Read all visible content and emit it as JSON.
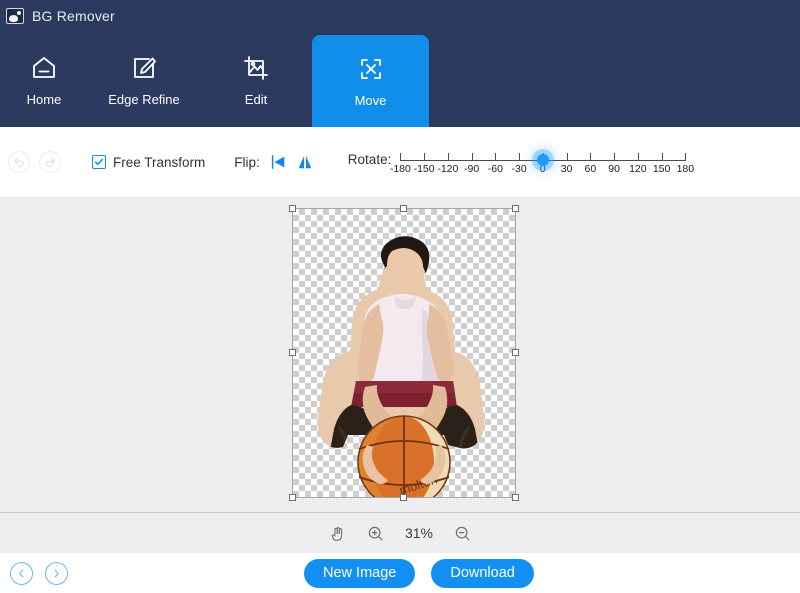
{
  "titlebar": {
    "app_name": "BG Remover",
    "icon": "image-photo-icon"
  },
  "nav": {
    "items": [
      {
        "label": "Home",
        "icon": "home-icon",
        "active": false
      },
      {
        "label": "Edge Refine",
        "icon": "pen-edit-square-icon",
        "active": false
      },
      {
        "label": "Edit",
        "icon": "image-crop-icon",
        "active": false
      },
      {
        "label": "Move",
        "icon": "move-arrows-icon",
        "active": true
      }
    ],
    "active_color": "#108ee9",
    "bar_color": "#2b3a5e"
  },
  "toolbar": {
    "undo_icon": "undo-arrow-icon",
    "redo_icon": "redo-arrow-icon",
    "free_transform_label": "Free Transform",
    "free_transform_checked": true,
    "flip_label": "Flip:",
    "flip_horizontal_icon": "flip-horizontal-icon",
    "flip_vertical_icon": "flip-vertical-icon",
    "rotate_label": "Rotate:",
    "rotate_value": 0,
    "rotate_min": -180,
    "rotate_max": 180,
    "rotate_ticks": [
      "-180",
      "-150",
      "-120",
      "-90",
      "-60",
      "-30",
      "0",
      "30",
      "60",
      "90",
      "120",
      "150",
      "180"
    ]
  },
  "canvas": {
    "background": "#eeeef0",
    "transparency_pattern": "checkerboard",
    "selection_handles": 8,
    "subject": "person holding a basketball"
  },
  "zoombar": {
    "hand_tool_icon": "hand-icon",
    "zoom_in_icon": "zoom-in-icon",
    "zoom_level": "31%",
    "zoom_out_icon": "zoom-out-icon"
  },
  "footer": {
    "prev_icon": "chevron-left-circle-icon",
    "next_icon": "chevron-right-circle-icon",
    "new_image_label": "New Image",
    "download_label": "Download",
    "button_color": "#128ff2"
  }
}
